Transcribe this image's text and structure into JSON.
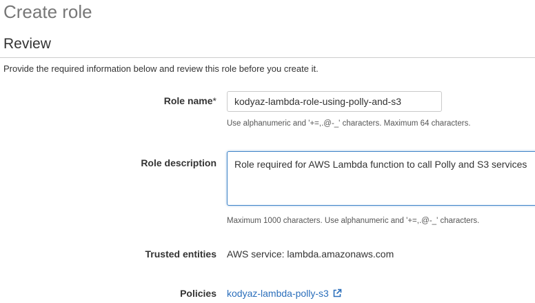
{
  "header": {
    "title": "Create role",
    "section": "Review",
    "intro": "Provide the required information below and review this role before you create it."
  },
  "form": {
    "role_name": {
      "label": "Role name",
      "required_marker": "*",
      "value": "kodyaz-lambda-role-using-polly-and-s3",
      "hint": "Use alphanumeric and '+=,.@-_' characters. Maximum 64 characters."
    },
    "role_description": {
      "label": "Role description",
      "value": "Role required for AWS Lambda function to call Polly and S3 services",
      "hint": "Maximum 1000 characters. Use alphanumeric and '+=,.@-_' characters."
    },
    "trusted_entities": {
      "label": "Trusted entities",
      "value": "AWS service: lambda.amazonaws.com"
    },
    "policies": {
      "label": "Policies",
      "link_text": "kodyaz-lambda-polly-s3",
      "icon": "external-link-icon"
    }
  },
  "colors": {
    "link": "#2a6ebb",
    "focus_border": "#3f84c8",
    "title_gray": "#777777"
  }
}
